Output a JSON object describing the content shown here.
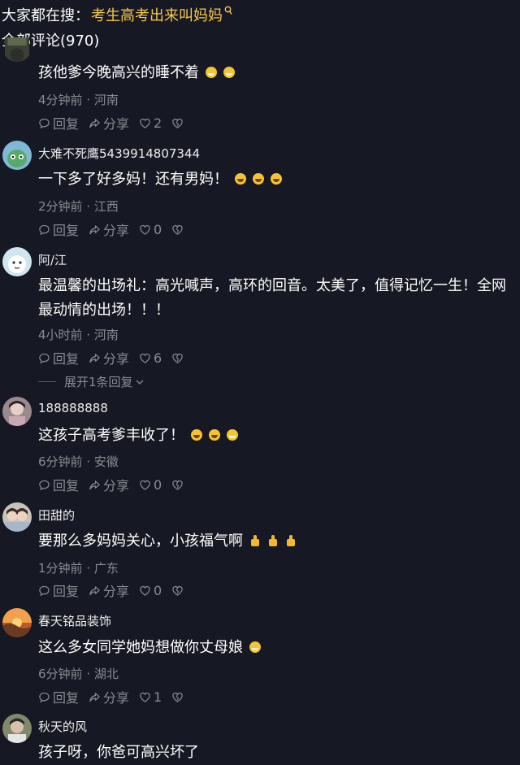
{
  "search_bar": {
    "prefix": "大家都在搜：",
    "query": "考生高考出来叫妈妈",
    "accent_color": "#f7c948",
    "icon": "search-icon"
  },
  "comments_header": {
    "label": "全部评论(970)"
  },
  "actions": {
    "reply": "回复",
    "share": "分享"
  },
  "comments": [
    {
      "username": "",
      "text": "孩他爹今晚高兴的睡不着",
      "emojis": [
        "sweat-smile",
        "sweat-smile"
      ],
      "time": "4分钟前",
      "location": "河南",
      "likes": "2"
    },
    {
      "username": "大难不死鹰5439914807344",
      "text": "一下多了好多妈！还有男妈！",
      "emojis": [
        "laugh-cry",
        "laugh",
        "laugh"
      ],
      "time": "2分钟前",
      "location": "江西",
      "likes": "0"
    },
    {
      "username": "阿/江",
      "text": "最温馨的出场礼：高光喊声，高环的回音。太美了，值得记忆一生！全网最动情的出场！！！",
      "emojis": [],
      "time": "4小时前",
      "location": "河南",
      "likes": "6",
      "expand_label": "展开1条回复"
    },
    {
      "username": "188888888",
      "text": "这孩子高考爹丰收了！",
      "emojis": [
        "laugh-cry",
        "laugh-cry",
        "grin"
      ],
      "time": "6分钟前",
      "location": "安徽",
      "likes": "0"
    },
    {
      "username": "田甜的",
      "text": "要那么多妈妈关心，小孩福气啊",
      "emojis": [
        "thumbs-up",
        "thumbs-up",
        "thumbs-up"
      ],
      "time": "1分钟前",
      "location": "广东",
      "likes": "0"
    },
    {
      "username": "春天铭品装饰",
      "text": "这么多女同学她妈想做你丈母娘",
      "emojis": [
        "grin"
      ],
      "time": "6分钟前",
      "location": "湖北",
      "likes": "1"
    },
    {
      "username": "秋天的风",
      "text": "孩子呀，你爸可高兴坏了",
      "emojis": [],
      "time": "",
      "location": "",
      "likes": ""
    }
  ],
  "meta_separator": " · "
}
